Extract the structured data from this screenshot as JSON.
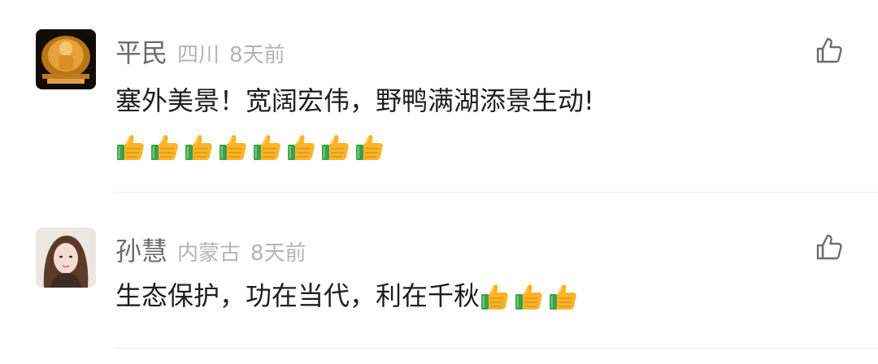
{
  "comments": [
    {
      "user": "平民",
      "location": "四川",
      "time": "8天前",
      "text": "塞外美景！宽阔宏伟，野鸭满湖添景生动!",
      "thumbs_count": 8
    },
    {
      "user": "孙慧",
      "location": "内蒙古",
      "time": "8天前",
      "text": "生态保护，功在当代，利在千秋",
      "thumbs_count": 3
    }
  ],
  "icons": {
    "like": "thumbs-up-outline-icon",
    "emoji": "thumbs-up-emoji-icon"
  },
  "colors": {
    "name": "#6b6b6b",
    "meta": "#b4b4b4",
    "text": "#1e1e1e",
    "divider": "#ececec"
  }
}
